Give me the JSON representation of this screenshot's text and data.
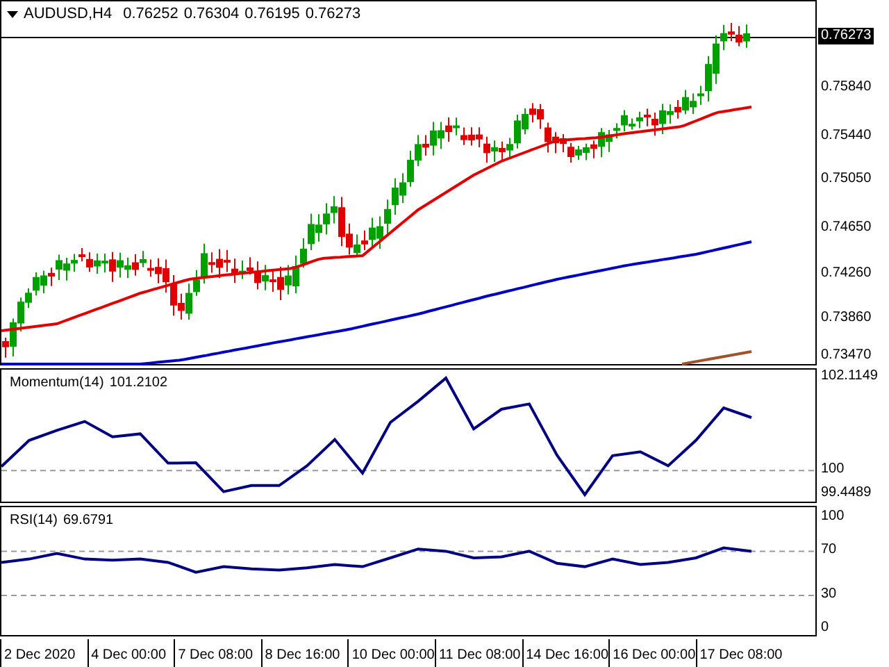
{
  "price_pane": {
    "symbol": "AUDUSD,H4",
    "ohlc": [
      "0.76252",
      "0.76304",
      "0.76195",
      "0.76273"
    ],
    "current_price": "0.76273",
    "axis_labels": [
      "0.75840",
      "0.75440",
      "0.75050",
      "0.74650",
      "0.74260",
      "0.73860",
      "0.73470"
    ]
  },
  "momentum_pane": {
    "reading": "101.2102",
    "chart_data": {
      "type": "line",
      "ylim": [
        99.259,
        102.305
      ],
      "yticks": [
        {
          "value": 102.1149,
          "label": "102.1149"
        },
        100,
        {
          "value": 99.4489,
          "label": "99.4489"
        }
      ],
      "series": [
        {
          "name": "Momentum(14)",
          "color": "#000080",
          "values": [
            100.09,
            100.69,
            100.92,
            101.12,
            100.77,
            100.84,
            100.17,
            100.18,
            99.52,
            99.66,
            99.66,
            100.11,
            100.71,
            99.94,
            101.1,
            101.58,
            102.11,
            100.95,
            101.4,
            101.52,
            100.35,
            99.45,
            100.34,
            100.43,
            100.11,
            100.69,
            101.43,
            101.21
          ]
        }
      ]
    }
  },
  "rsi_pane": {
    "reading": "69.6791",
    "chart_data": {
      "type": "line",
      "ylim": [
        -6,
        110
      ],
      "yticks": [
        100,
        70,
        30,
        0
      ],
      "series": [
        {
          "name": "RSI(14)",
          "color": "#000080",
          "values": [
            60,
            63,
            68,
            63,
            62,
            63,
            60,
            51,
            56,
            54,
            53,
            55,
            58,
            56,
            64,
            72,
            70,
            64,
            65,
            70,
            59,
            56,
            63,
            58,
            60,
            64,
            73,
            70
          ]
        }
      ]
    }
  },
  "time_axis": [
    "2 Dec 2020",
    "4 Dec 00:00",
    "7 Dec 08:00",
    "8 Dec 16:00",
    "10 Dec 00:00",
    "11 Dec 08:00",
    "14 Dec 16:00",
    "16 Dec 00:00",
    "17 Dec 08:00"
  ]
}
